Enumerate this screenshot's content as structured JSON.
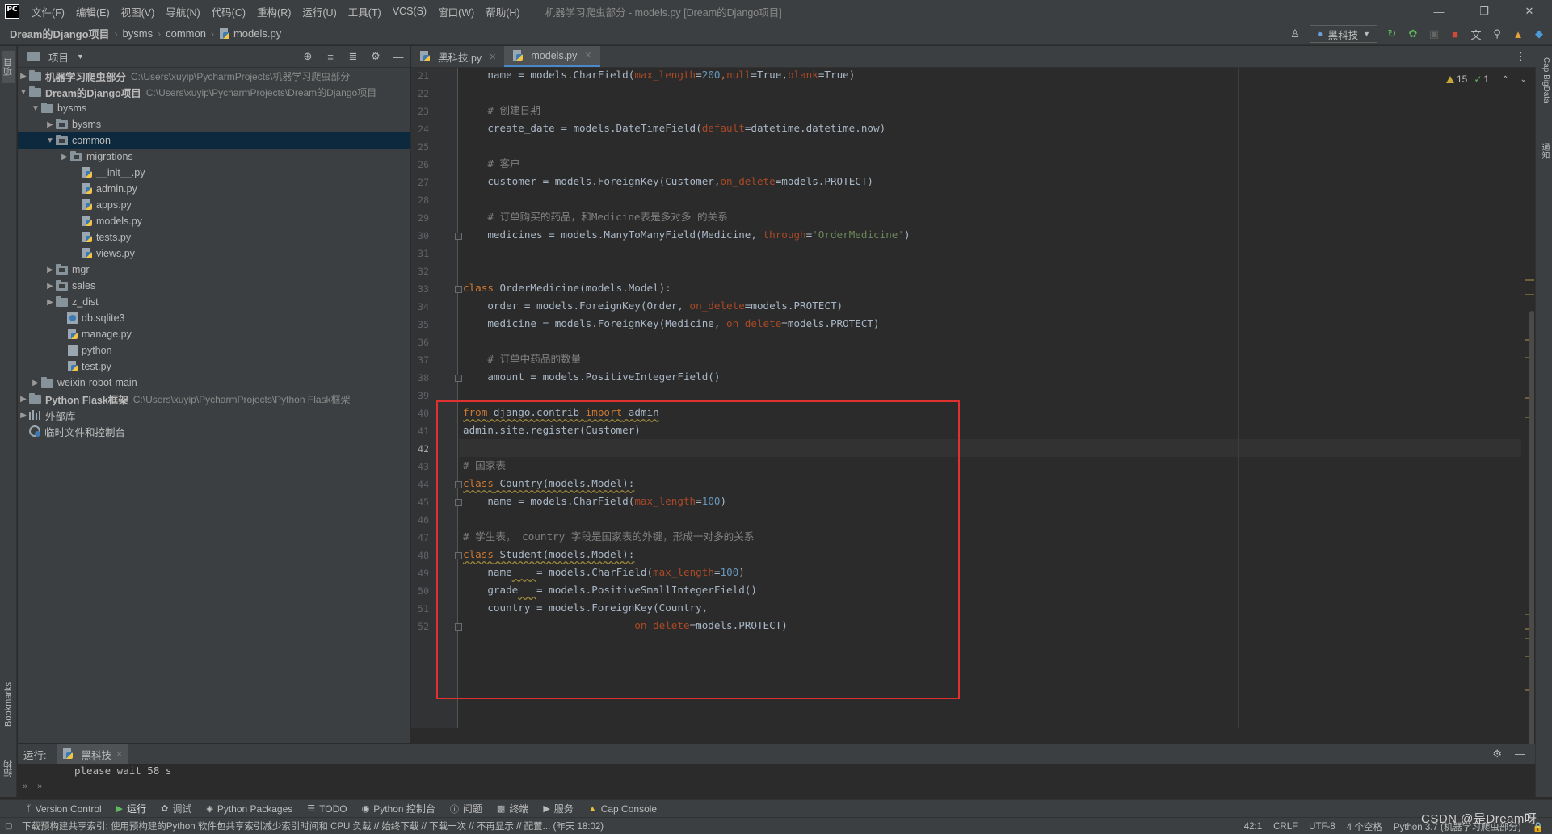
{
  "menubar": {
    "logo": "PC",
    "items": [
      "文件(F)",
      "编辑(E)",
      "视图(V)",
      "导航(N)",
      "代码(C)",
      "重构(R)",
      "运行(U)",
      "工具(T)",
      "VCS(S)",
      "窗口(W)",
      "帮助(H)"
    ],
    "title": "机器学习爬虫部分 - models.py [Dream的Django项目]"
  },
  "breadcrumb": [
    "Dream的Django项目",
    "bysms",
    "common",
    "models.py"
  ],
  "toolbar": {
    "run_config": "黑科技"
  },
  "left_strip": {
    "project_tab": "项目",
    "bookmarks_tab": "Bookmarks",
    "structure_tab": "结构"
  },
  "right_strip": {
    "bigdata_tab": "Cap BigData",
    "notify_tab": "通知"
  },
  "project_panel": {
    "title": "项目",
    "tree": [
      {
        "label": "机器学习爬虫部分",
        "path": "C:\\Users\\xuyip\\PycharmProjects\\机器学习爬虫部分"
      },
      {
        "label": "Dream的Django项目",
        "path": "C:\\Users\\xuyip\\PycharmProjects\\Dream的Django项目"
      },
      {
        "label": "bysms"
      },
      {
        "label": "bysms"
      },
      {
        "label": "common"
      },
      {
        "label": "migrations"
      },
      {
        "label": "__init__.py"
      },
      {
        "label": "admin.py"
      },
      {
        "label": "apps.py"
      },
      {
        "label": "models.py"
      },
      {
        "label": "tests.py"
      },
      {
        "label": "views.py"
      },
      {
        "label": "mgr"
      },
      {
        "label": "sales"
      },
      {
        "label": "z_dist"
      },
      {
        "label": "db.sqlite3"
      },
      {
        "label": "manage.py"
      },
      {
        "label": "python"
      },
      {
        "label": "test.py"
      },
      {
        "label": "weixin-robot-main"
      },
      {
        "label": "Python Flask框架",
        "path": "C:\\Users\\xuyip\\PycharmProjects\\Python Flask框架"
      },
      {
        "label": "外部库"
      },
      {
        "label": "临时文件和控制台"
      }
    ]
  },
  "editor": {
    "tabs": [
      {
        "label": "黑科技.py"
      },
      {
        "label": "models.py"
      }
    ],
    "inspections": {
      "warnings": "15",
      "ok": "1"
    },
    "line_numbers": [
      "21",
      "22",
      "23",
      "24",
      "25",
      "26",
      "27",
      "28",
      "29",
      "30",
      "31",
      "32",
      "33",
      "34",
      "35",
      "36",
      "37",
      "38",
      "39",
      "40",
      "41",
      "42",
      "43",
      "44",
      "45",
      "46",
      "47",
      "48",
      "49",
      "50",
      "51",
      "52"
    ],
    "code": {
      "l21a": "    name = models.CharField(",
      "l21b": "max_length",
      "l21c": "=",
      "l21d": "200",
      "l21e": ",",
      "l21f": "null",
      "l21g": "=True,",
      "l21h": "blank",
      "l21i": "=True)",
      "l23": "    # 创建日期",
      "l24a": "    create_date = models.DateTimeField(",
      "l24b": "default",
      "l24c": "=datetime.datetime.now)",
      "l26": "    # 客户",
      "l27a": "    customer = models.ForeignKey(Customer,",
      "l27b": "on_delete",
      "l27c": "=models.PROTECT)",
      "l29": "    # 订单购买的药品，和Medicine表是多对多 的关系",
      "l30a": "    medicines = models.ManyToManyField(Medicine, ",
      "l30b": "through",
      "l30c": "=",
      "l30d": "'OrderMedicine'",
      "l30e": ")",
      "l33a": "class",
      "l33b": " OrderMedicine(models.Model):",
      "l34a": "    order = models.ForeignKey(Order, ",
      "l34b": "on_delete",
      "l34c": "=models.PROTECT)",
      "l35a": "    medicine = models.ForeignKey(Medicine, ",
      "l35b": "on_delete",
      "l35c": "=models.PROTECT)",
      "l37": "    # 订单中药品的数量",
      "l38": "    amount = models.PositiveIntegerField()",
      "l40a": "from",
      "l40b": " django.contrib ",
      "l40c": "import",
      "l40d": " admin",
      "l41": "admin.site.register(Customer)",
      "l43": "# 国家表",
      "l44a": "class",
      "l44b": " Country(models.Model):",
      "l45a": "    name = models.CharField(",
      "l45b": "max_length",
      "l45c": "=",
      "l45d": "100",
      "l45e": ")",
      "l47": "# 学生表， country 字段是国家表的外键，形成一对多的关系",
      "l48a": "class",
      "l48b": " Student(models.Model):",
      "l49a": "    name",
      "l49b": "    ",
      "l49c": "= models.CharField(",
      "l49d": "max_length",
      "l49e": "=",
      "l49f": "100",
      "l49g": ")",
      "l50a": "    grade",
      "l50b": "   ",
      "l50c": "= models.PositiveSmallIntegerField()",
      "l51": "    country = models.ForeignKey(Country,",
      "l52a": "                            ",
      "l52b": "on_delete",
      "l52c": "=models.PROTECT)"
    }
  },
  "run_panel": {
    "label": "运行:",
    "tab": "黑科技",
    "output": "please wait 58 s"
  },
  "bottom_tools": [
    "Version Control",
    "运行",
    "调试",
    "Python Packages",
    "TODO",
    "Python 控制台",
    "问题",
    "终端",
    "服务",
    "Cap Console"
  ],
  "status": {
    "message": "下载预构建共享索引: 使用预构建的Python 软件包共享索引减少索引时间和 CPU 负载 // 始终下载 // 下载一次 // 不再显示 // 配置... (昨天 18:02)",
    "position": "42:1",
    "line_sep": "CRLF",
    "encoding": "UTF-8",
    "indent": "4 个空格",
    "interpreter": "Python 3.7 (机器学习爬虫部分)"
  },
  "watermark": "CSDN @是Dream呀",
  "colors": {
    "keyword": "#cc7832",
    "param": "#aa4926",
    "number": "#6897bb",
    "string": "#6a8759",
    "comment": "#808080",
    "highlight_box": "#e03030"
  }
}
